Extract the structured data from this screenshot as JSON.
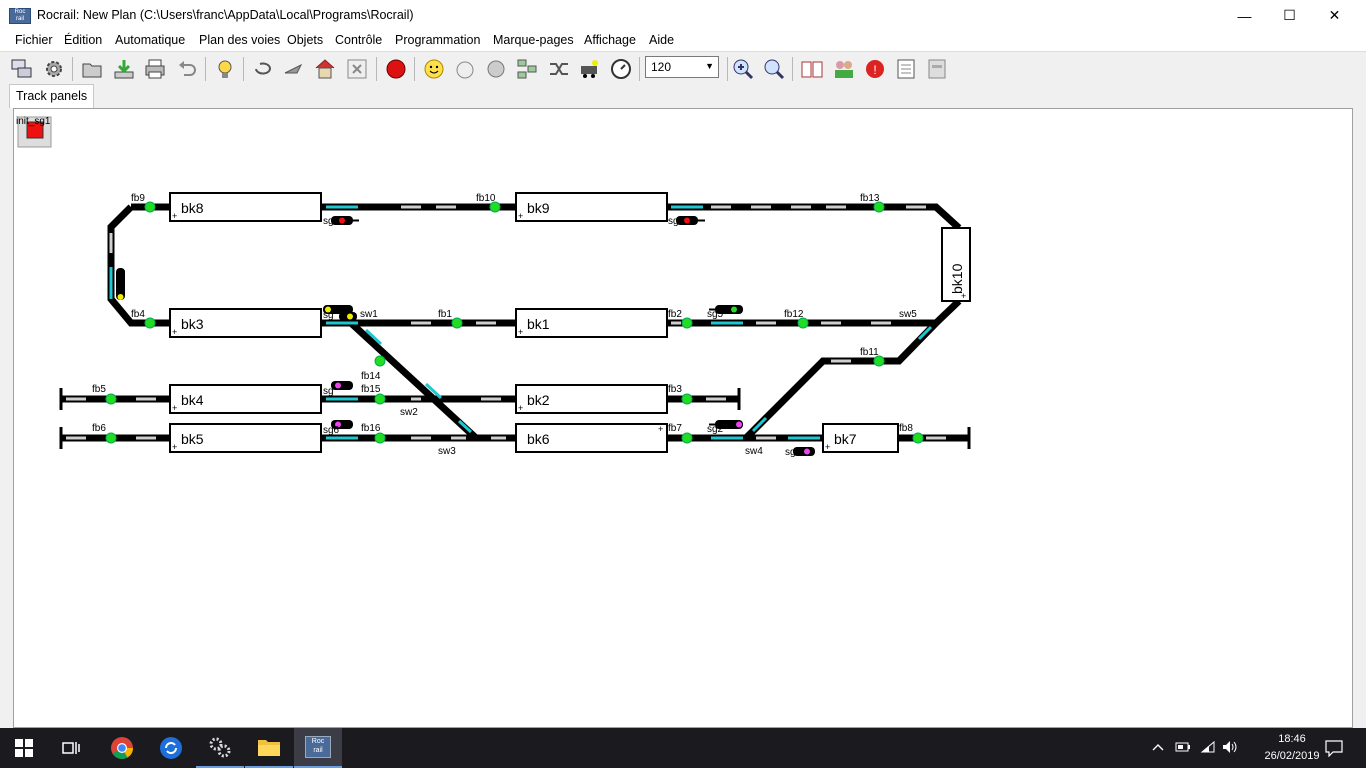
{
  "window": {
    "title": "Rocrail: New Plan (C:\\Users\\franc\\AppData\\Local\\Programs\\Rocrail)",
    "app_icon_text_top": "Roc",
    "app_icon_text_bottom": "rail",
    "minimize": "—",
    "maximize": "☐",
    "close": "✕"
  },
  "menu": [
    "Fichier",
    "Édition",
    "Automatique",
    "Plan des voies",
    "Objets",
    "Contrôle",
    "Programmation",
    "Marque-pages",
    "Affichage",
    "Aide"
  ],
  "toolbar": {
    "zoom_value": "120",
    "icons": [
      "connect-icon",
      "settings-icon",
      "open-icon",
      "download-icon",
      "print-icon",
      "undo-icon",
      "lightbulb-icon",
      "loop-icon",
      "plane-icon",
      "house-icon",
      "cancel-icon",
      "emergency-stop-icon",
      "smiley-icon",
      "clock-icon",
      "cloud-icon",
      "grid-icon",
      "shuffle-icon",
      "locomotive-icon",
      "gauge-icon",
      "zoom-in-icon",
      "zoom-out-icon",
      "book-icon",
      "users-icon",
      "alert-icon",
      "notepad-icon",
      "archive-icon"
    ]
  },
  "tabs": {
    "track_panels": "Track panels"
  },
  "plan": {
    "init_label": "init_sg1",
    "blocks": {
      "bk8": "bk8",
      "bk9": "bk9",
      "bk10": "bk10",
      "bk3": "bk3",
      "bk1": "bk1",
      "bk4": "bk4",
      "bk2": "bk2",
      "bk5": "bk5",
      "bk6": "bk6",
      "bk7": "bk7"
    },
    "block_plus": "+",
    "feedbacks": {
      "fb9": "fb9",
      "fb10": "fb10",
      "fb13": "fb13",
      "fb4": "fb4",
      "fb1": "fb1",
      "fb2": "fb2",
      "fb12": "fb12",
      "fb11": "fb11",
      "fb14": "fb14",
      "fb15": "fb15",
      "fb5": "fb5",
      "fb3": "fb3",
      "fb6": "fb6",
      "fb16": "fb16",
      "fb7": "fb7",
      "fb8": "fb8"
    },
    "switches": {
      "sw1": "sw1",
      "sw2": "sw2",
      "sw3": "sw3",
      "sw4": "sw4",
      "sw5": "sw5"
    },
    "signals": {
      "sg_a": "sg",
      "sg_b": "sg",
      "sg_c": "sg",
      "sg_d": "sg5",
      "sg_e": "sg",
      "sg_f": "sg",
      "sg_g": "sg6",
      "sg_h": "sg2",
      "sg_i": "sg"
    },
    "colors": {
      "track": "#000000",
      "occupied": "#1fc8d0",
      "feedback_on": "#22dd22",
      "signal_red": "#ee1111",
      "signal_magenta": "#ee44ee",
      "signal_yellow": "#eeee00"
    }
  },
  "taskbar": {
    "time": "18:46",
    "date": "26/02/2019",
    "apps": [
      "windows-start-icon",
      "task-view-icon",
      "chrome-icon",
      "sync-icon",
      "gears-icon",
      "file-explorer-icon",
      "rocrail-icon"
    ],
    "rocrail_top": "Roc",
    "rocrail_bottom": "rail"
  }
}
